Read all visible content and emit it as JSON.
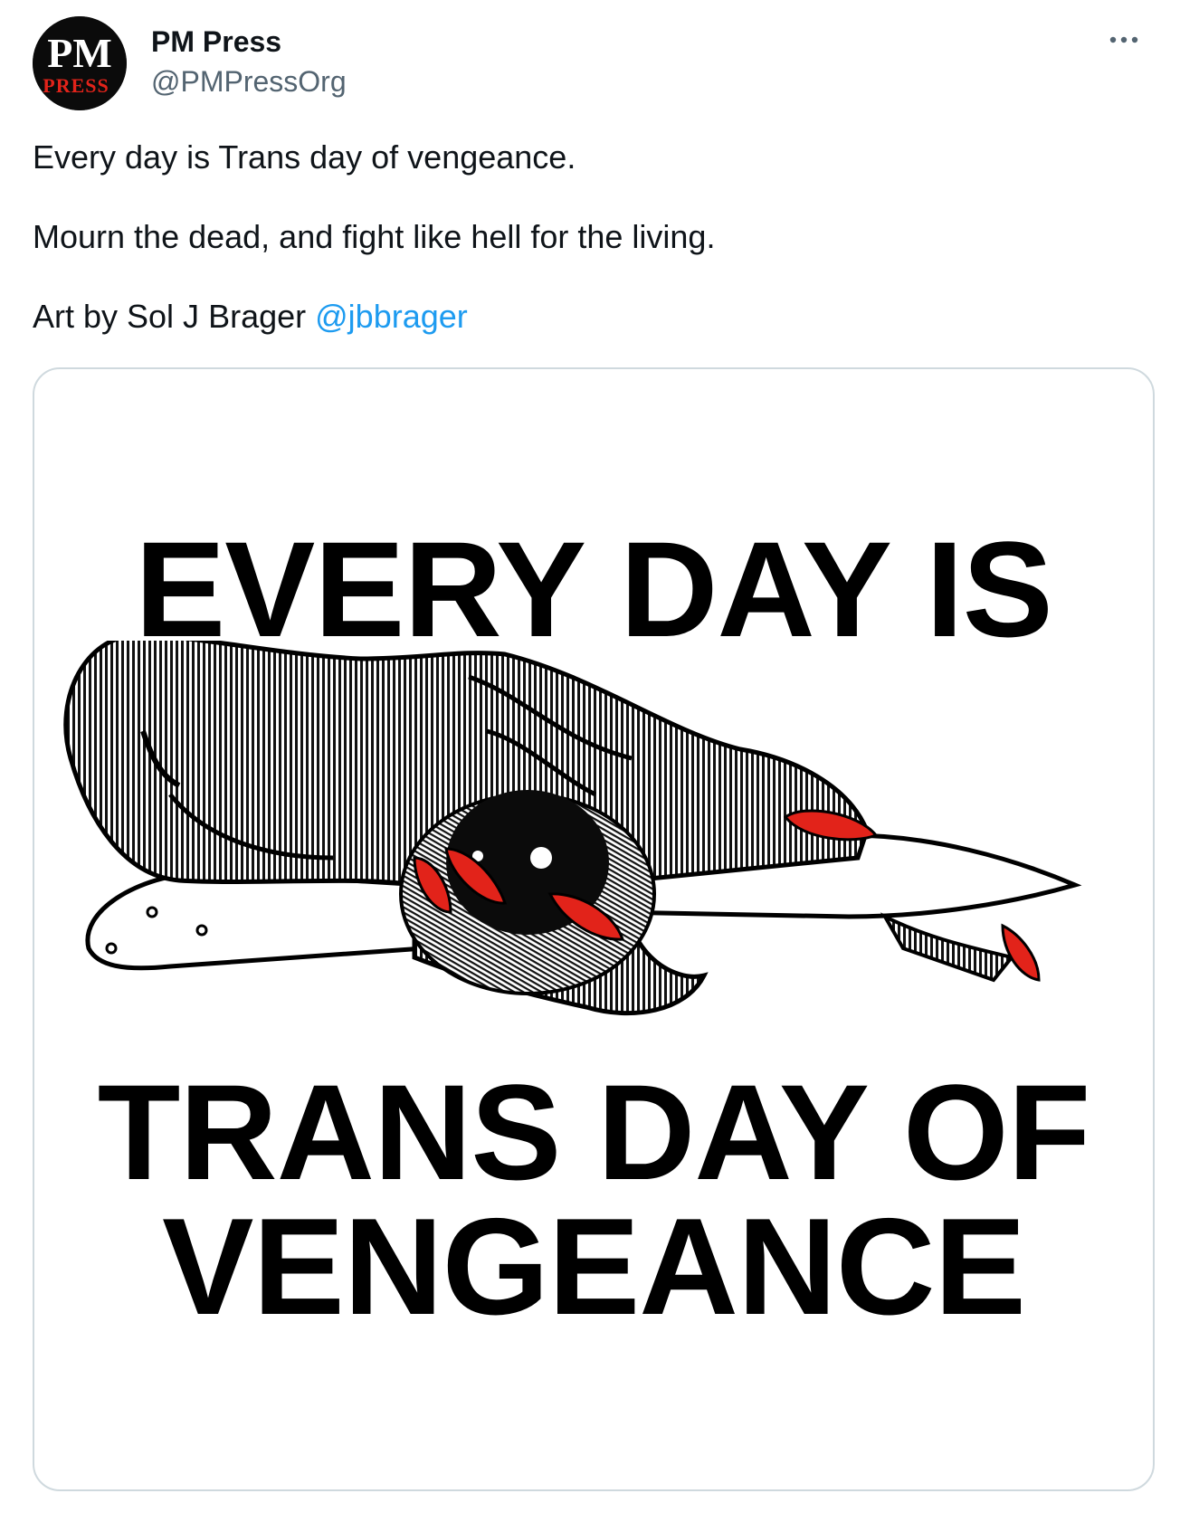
{
  "author": {
    "display_name": "PM Press",
    "handle": "@PMPressOrg",
    "avatar_text": "PM",
    "avatar_subtext": "PRESS"
  },
  "menu": {
    "more_glyph": "···"
  },
  "tweet": {
    "paragraph_1": "Every day is Trans day of vengeance.",
    "paragraph_2": "Mourn the dead, and fight like hell for the living.",
    "paragraph_3_prefix": "Art by Sol J Brager ",
    "mention": "@jbbrager"
  },
  "media": {
    "line_1": "EVERY DAY IS",
    "line_2": "TRANS DAY OF",
    "line_3": "VENGEANCE",
    "icon": "hand-holding-knife-illustration"
  },
  "colors": {
    "text": "#0f1419",
    "secondary": "#536471",
    "link": "#1d9bf0",
    "border": "#cfd9de",
    "nail_red": "#e2231a"
  }
}
